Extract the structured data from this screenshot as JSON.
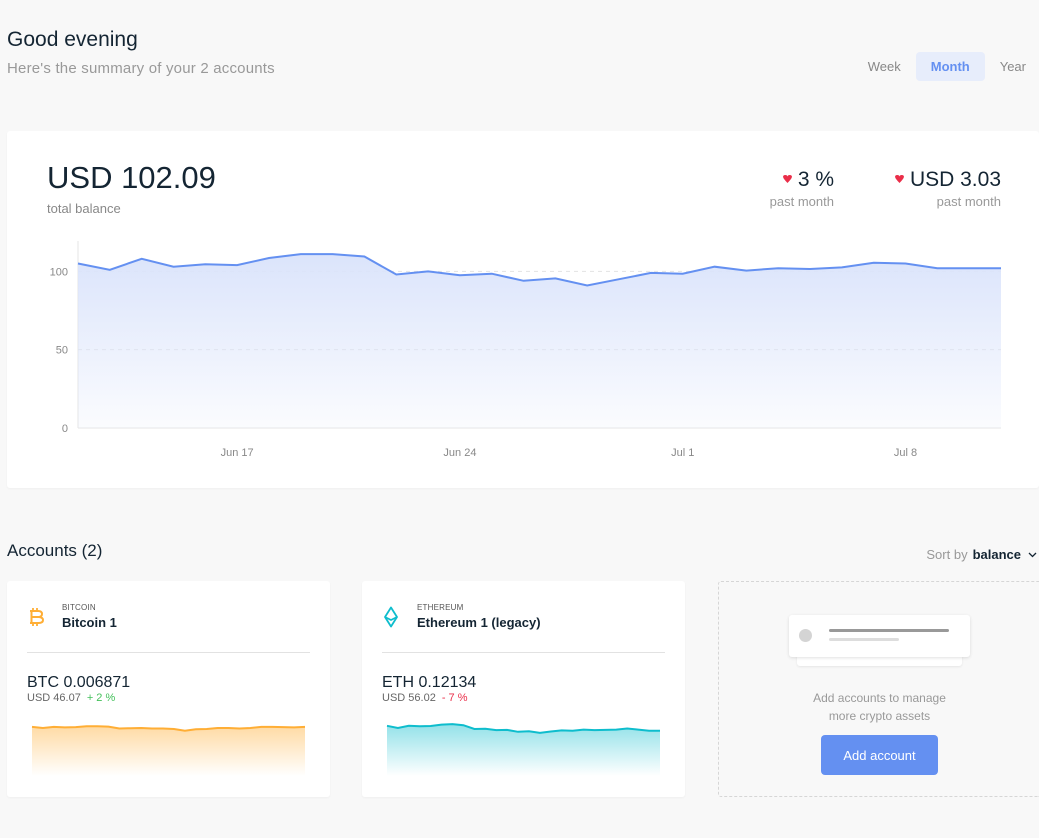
{
  "header": {
    "greeting": "Good evening",
    "subtitle": "Here's the summary of your 2 accounts",
    "range_tabs": [
      {
        "label": "Week",
        "active": false
      },
      {
        "label": "Month",
        "active": true
      },
      {
        "label": "Year",
        "active": false
      }
    ]
  },
  "summary": {
    "balance": "USD 102.09",
    "balance_label": "total balance",
    "change_pct": "3 %",
    "change_pct_label": "past month",
    "change_usd": "USD 3.03",
    "change_usd_label": "past month",
    "change_direction": "down"
  },
  "chart_data": {
    "type": "area",
    "title": "",
    "xlabel": "",
    "ylabel": "",
    "y_ticks": [
      0,
      50,
      100
    ],
    "ylim": [
      0,
      113
    ],
    "x_tick_labels": [
      {
        "label": "Jun 17",
        "index": 5
      },
      {
        "label": "Jun 24",
        "index": 12
      },
      {
        "label": "Jul 1",
        "index": 19
      },
      {
        "label": "Jul 8",
        "index": 26
      }
    ],
    "values": [
      105,
      101,
      108,
      103,
      104.5,
      104,
      108.5,
      111,
      111,
      109.5,
      98,
      100,
      97.5,
      98.5,
      94,
      95.5,
      91,
      95,
      99,
      98.5,
      103,
      100.5,
      102,
      101.5,
      102.5,
      105.5,
      105,
      102,
      102,
      102
    ],
    "colors": {
      "line": "#6490f1",
      "fill": "#dbe4fb"
    },
    "grid": true
  },
  "accounts": {
    "title": "Accounts (2)",
    "sort_label": "Sort by",
    "sort_value": "balance",
    "items": [
      {
        "currency": "BITCOIN",
        "name": "Bitcoin 1",
        "amount": "BTC 0.006871",
        "usd": "USD 46.07",
        "change": "+ 2 %",
        "color": "#ffae35",
        "icon": "bitcoin-icon",
        "spark": [
          93,
          91,
          93,
          92,
          92.5,
          94,
          94,
          93.5,
          90,
          90.5,
          91,
          90,
          90,
          89,
          86,
          88.5,
          89,
          91,
          91,
          90,
          91,
          93,
          93,
          92.5,
          92,
          93
        ]
      },
      {
        "currency": "ETHEREUM",
        "name": "Ethereum 1 (legacy)",
        "amount": "ETH 0.12134",
        "usd": "USD 56.02",
        "change": "- 7 %",
        "color": "#0ebdcd",
        "icon": "ethereum-icon",
        "spark": [
          95,
          91,
          95,
          94,
          94.5,
          97,
          98,
          96,
          89,
          89.5,
          87,
          87.5,
          84,
          85,
          82,
          84.5,
          86.5,
          86,
          88,
          87,
          87.5,
          88,
          90,
          88,
          86,
          86
        ]
      }
    ]
  },
  "add_account": {
    "text_line1": "Add accounts to manage",
    "text_line2": "more crypto assets",
    "button_label": "Add account"
  }
}
